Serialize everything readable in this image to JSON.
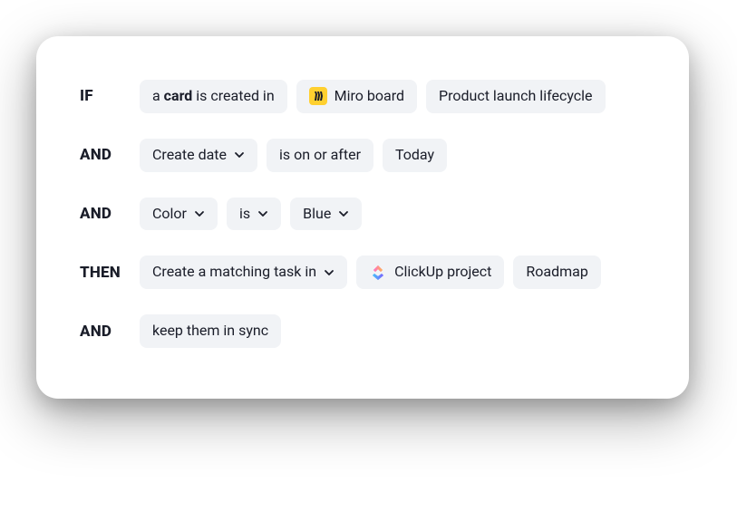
{
  "rules": {
    "row1": {
      "keyword": "IF",
      "trigger_prefix": "a ",
      "trigger_bold": "card",
      "trigger_suffix": " is created in",
      "app_label": "Miro board",
      "target": "Product launch lifecycle"
    },
    "row2": {
      "keyword": "AND",
      "field": "Create date",
      "operator": "is on or after",
      "value": "Today"
    },
    "row3": {
      "keyword": "AND",
      "field": "Color",
      "operator": "is",
      "value": "Blue"
    },
    "row4": {
      "keyword": "THEN",
      "action": "Create a matching task in",
      "app_label": "ClickUp project",
      "target": "Roadmap"
    },
    "row5": {
      "keyword": "AND",
      "text": "keep them in sync"
    }
  }
}
